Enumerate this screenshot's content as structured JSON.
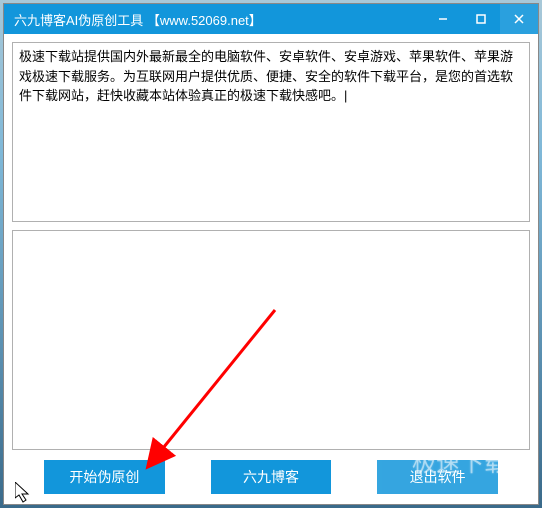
{
  "titlebar": {
    "title": "六九博客AI伪原创工具 【www.52069.net】"
  },
  "input": {
    "text": "极速下载站提供国内外最新最全的电脑软件、安卓软件、安卓游戏、苹果软件、苹果游戏极速下载服务。为互联网用户提供优质、便捷、安全的软件下载平台，是您的首选软件下载网站，赶快收藏本站体验真正的极速下载快感吧。|"
  },
  "output": {
    "text": ""
  },
  "buttons": {
    "start": "开始伪原创",
    "blog": "六九博客",
    "exit": "退出软件"
  },
  "watermark": "极速下载站"
}
